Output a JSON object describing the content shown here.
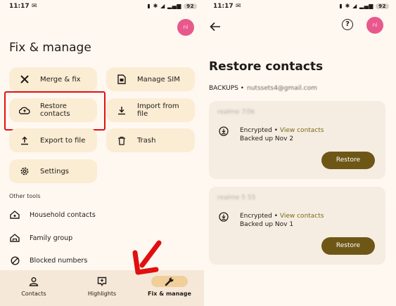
{
  "left": {
    "status": {
      "time": "11:17",
      "battery": "92"
    },
    "title": "Fix & manage",
    "tiles": [
      {
        "label": "Merge & fix",
        "icon": "tools-icon"
      },
      {
        "label": "Manage SIM",
        "icon": "sim-icon"
      },
      {
        "label": "Restore\ncontacts",
        "icon": "cloud-restore-icon"
      },
      {
        "label": "Import from\nfile",
        "icon": "download-icon"
      },
      {
        "label": "Export to file",
        "icon": "upload-icon"
      },
      {
        "label": "Trash",
        "icon": "trash-icon"
      },
      {
        "label": "Settings",
        "icon": "gear-icon"
      }
    ],
    "other_tools_label": "Other tools",
    "tools": [
      {
        "label": "Household contacts",
        "icon": "home-icon"
      },
      {
        "label": "Family group",
        "icon": "family-icon"
      },
      {
        "label": "Blocked numbers",
        "icon": "block-icon"
      }
    ],
    "nav": [
      {
        "label": "Contacts",
        "icon": "person-icon"
      },
      {
        "label": "Highlights",
        "icon": "highlights-icon"
      },
      {
        "label": "Fix & manage",
        "icon": "wrench-icon"
      }
    ]
  },
  "right": {
    "status": {
      "time": "11:17",
      "battery": "92"
    },
    "title": "Restore contacts",
    "backups_label": "BACKUPS •",
    "backups_account": "nutssets4@gmail.com",
    "backups": [
      {
        "device": "realme 7i5k",
        "encrypted": "Encrypted",
        "link": "View contacts",
        "date": "Backed up Nov 2",
        "button": "Restore"
      },
      {
        "device": "realme 5 55",
        "encrypted": "Encrypted",
        "link": "View contacts",
        "date": "Backed up Nov 1",
        "button": "Restore"
      }
    ]
  },
  "colors": {
    "bg": "#fff8f1",
    "tile": "#fbecd4",
    "button": "#6e5716",
    "highlight": "#e01010",
    "avatar": "#e8588c"
  }
}
